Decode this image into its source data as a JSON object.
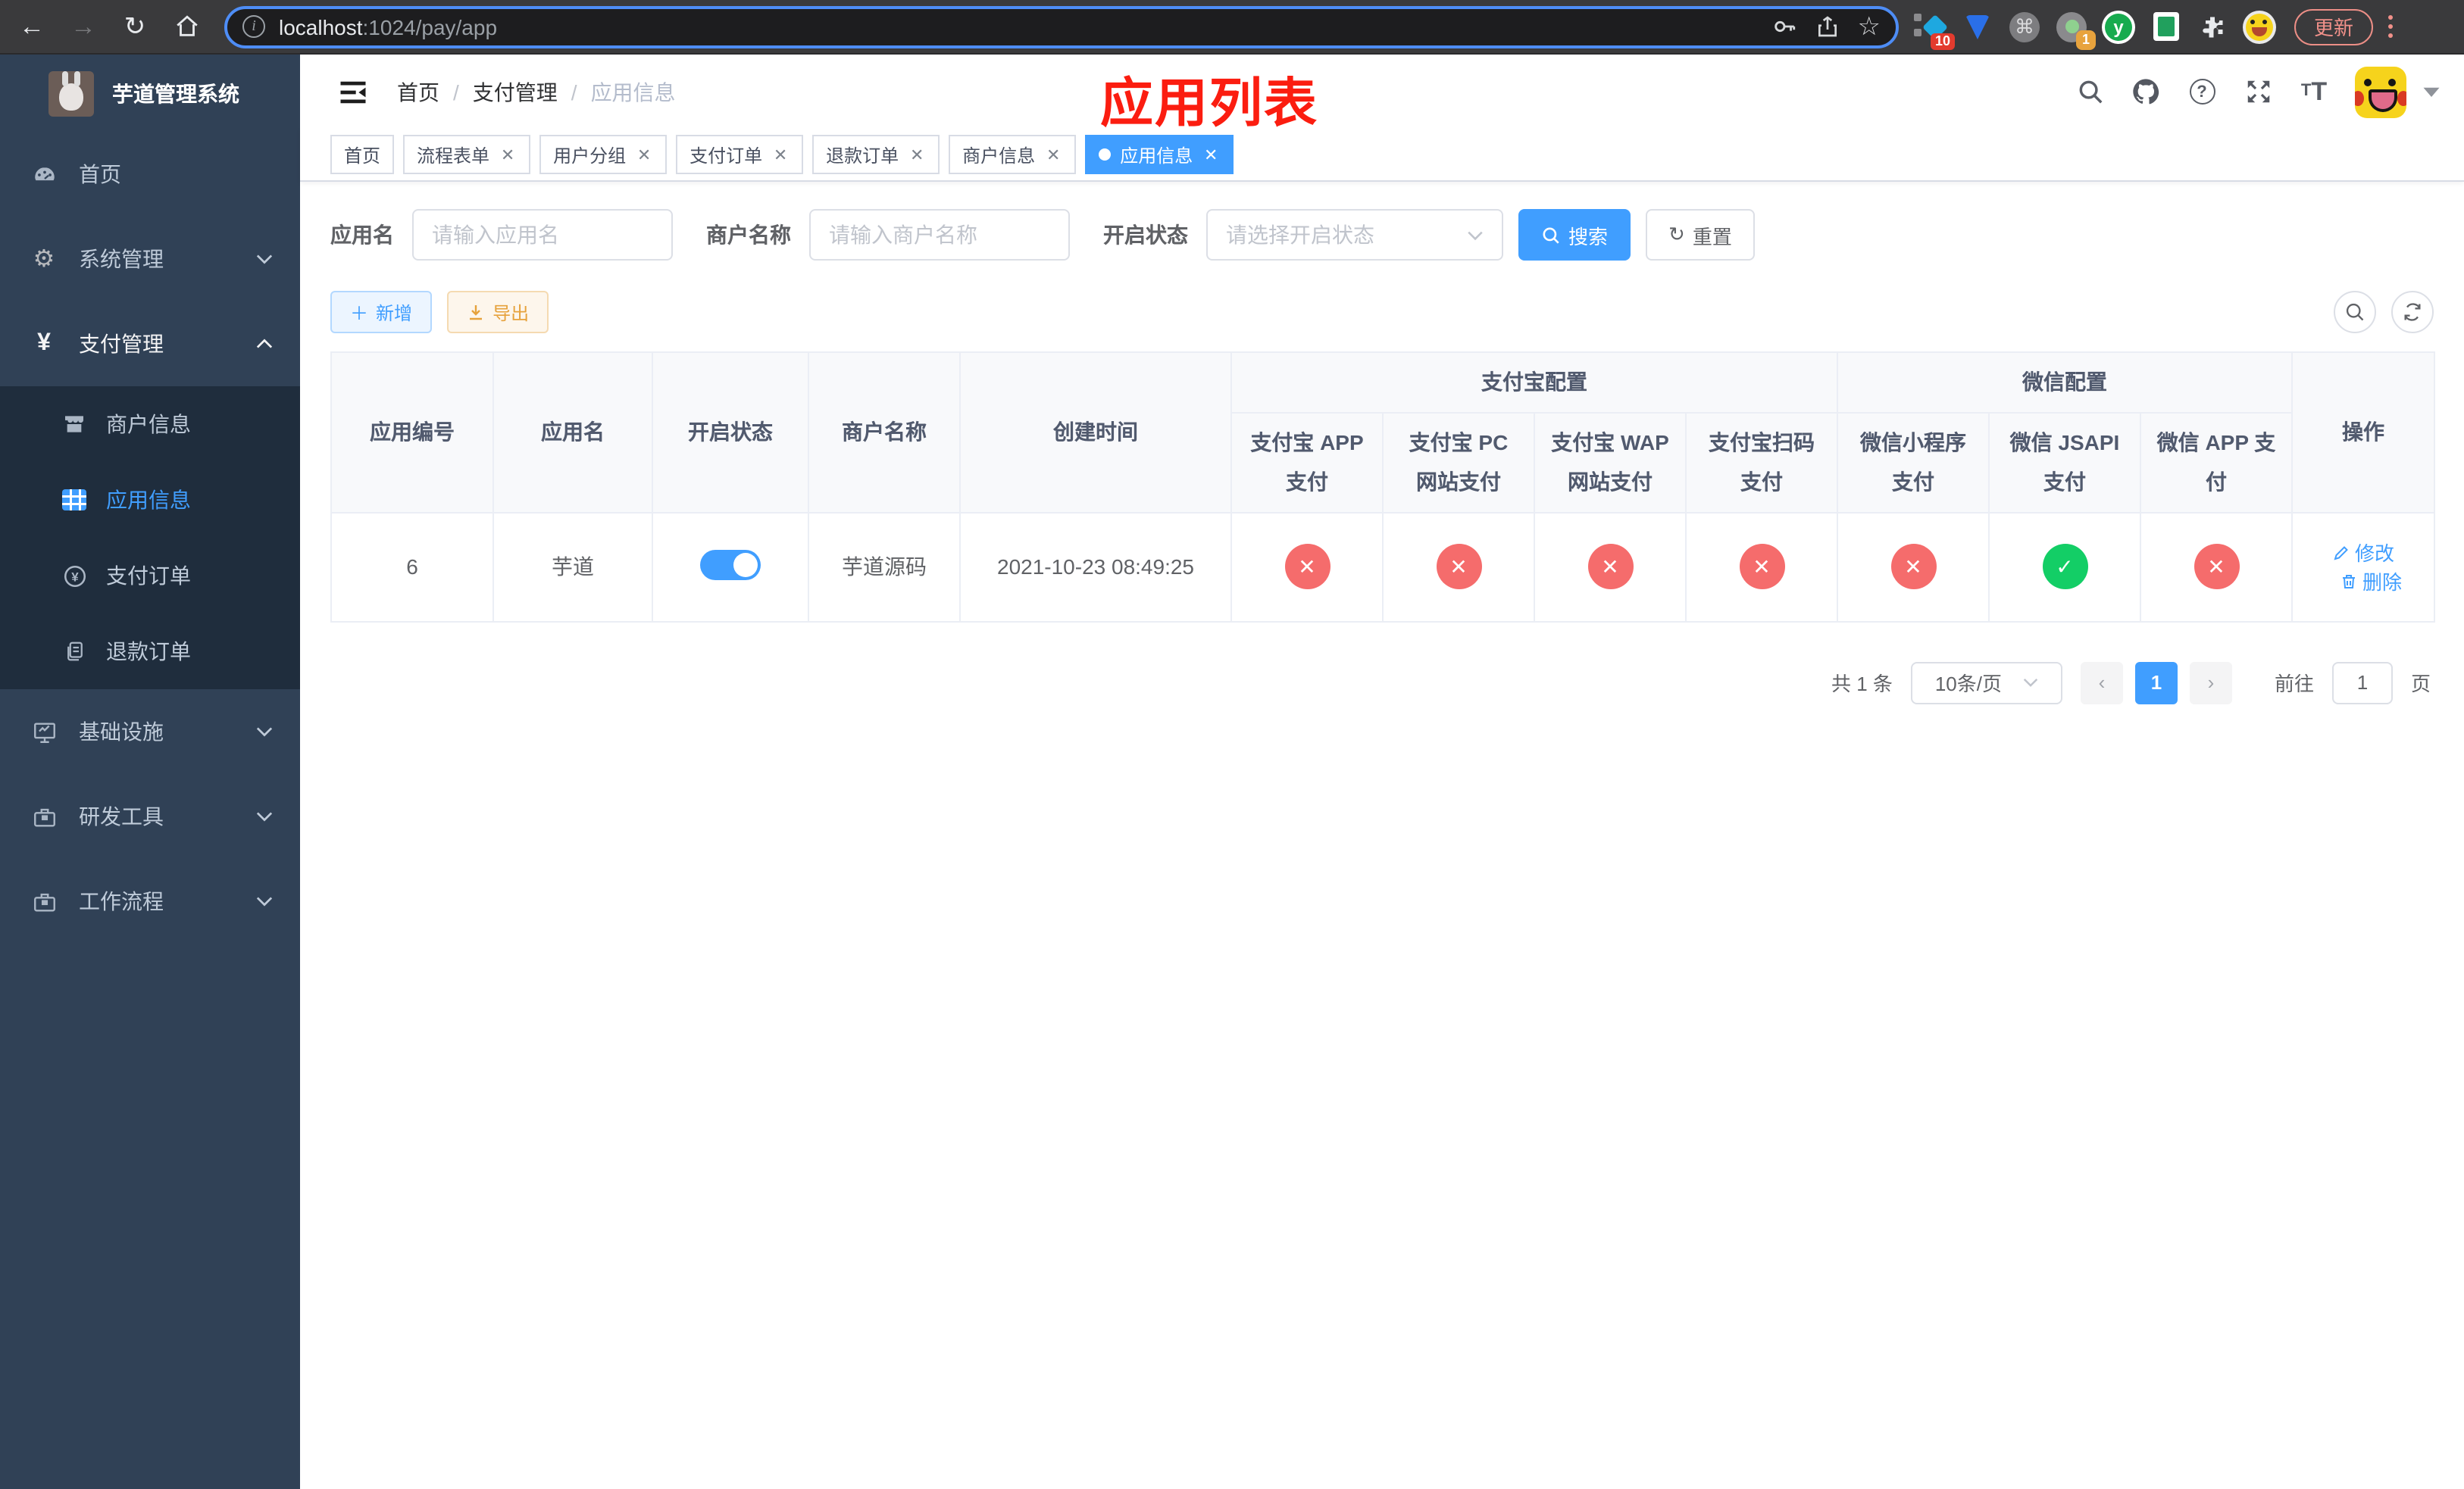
{
  "browser": {
    "url_domain": "localhost",
    "url_path": ":1024/pay/app",
    "ext_badge_count": "10",
    "session_badge_count": "1",
    "update_button": "更新"
  },
  "sidebar": {
    "title": "芋道管理系统",
    "items": [
      {
        "label": "首页",
        "icon": "dashboard-icon"
      },
      {
        "label": "系统管理",
        "icon": "gear-icon"
      },
      {
        "label": "支付管理",
        "icon": "yen-icon"
      },
      {
        "label": "基础设施",
        "icon": "monitor-icon"
      },
      {
        "label": "研发工具",
        "icon": "toolbox-icon"
      },
      {
        "label": "工作流程",
        "icon": "briefcase-icon"
      }
    ],
    "submenu": [
      {
        "label": "商户信息",
        "icon": "storefront-icon"
      },
      {
        "label": "应用信息",
        "icon": "grid-icon"
      },
      {
        "label": "支付订单",
        "icon": "yen-circle-icon"
      },
      {
        "label": "退款订单",
        "icon": "document-icon"
      }
    ]
  },
  "header": {
    "breadcrumb": [
      "首页",
      "支付管理",
      "应用信息"
    ],
    "breadcrumb_separator": "/",
    "annotation": "应用列表"
  },
  "tabs": [
    {
      "label": "首页"
    },
    {
      "label": "流程表单"
    },
    {
      "label": "用户分组"
    },
    {
      "label": "支付订单"
    },
    {
      "label": "退款订单"
    },
    {
      "label": "商户信息"
    },
    {
      "label": "应用信息"
    }
  ],
  "filters": {
    "app_name_label": "应用名",
    "app_name_placeholder": "请输入应用名",
    "merchant_label": "商户名称",
    "merchant_placeholder": "请输入商户名称",
    "status_label": "开启状态",
    "status_placeholder": "请选择开启状态",
    "search_button": "搜索",
    "reset_button": "重置"
  },
  "toolbar": {
    "add_button": "新增",
    "export_button": "导出"
  },
  "table": {
    "columns": [
      "应用编号",
      "应用名",
      "开启状态",
      "商户名称",
      "创建时间"
    ],
    "group_alipay": "支付宝配置",
    "group_wechat": "微信配置",
    "alipay_columns": [
      "支付宝 APP 支付",
      "支付宝 PC 网站支付",
      "支付宝 WAP 网站支付",
      "支付宝扫码支付"
    ],
    "wechat_columns": [
      "微信小程序支付",
      "微信 JSAPI 支付",
      "微信 APP 支付"
    ],
    "action_column": "操作",
    "rows": [
      {
        "id": "6",
        "name": "芋道",
        "enabled": true,
        "merchant": "芋道源码",
        "created": "2021-10-23 08:49:25",
        "statuses": [
          "no",
          "no",
          "no",
          "no",
          "no",
          "yes",
          "no"
        ],
        "edit_action": "修改",
        "delete_action": "删除"
      }
    ]
  },
  "pagination": {
    "total": "共 1 条",
    "page_size": "10条/页",
    "current_page": "1",
    "goto_label": "前往",
    "goto_value": "1",
    "page_suffix": "页"
  },
  "colors": {
    "primary": "#409eff",
    "success": "#13ce66",
    "danger": "#f56c6c",
    "sidebar_bg": "#304156",
    "submenu_bg": "#1f2d3d",
    "annotation_red": "#fb1d10"
  }
}
